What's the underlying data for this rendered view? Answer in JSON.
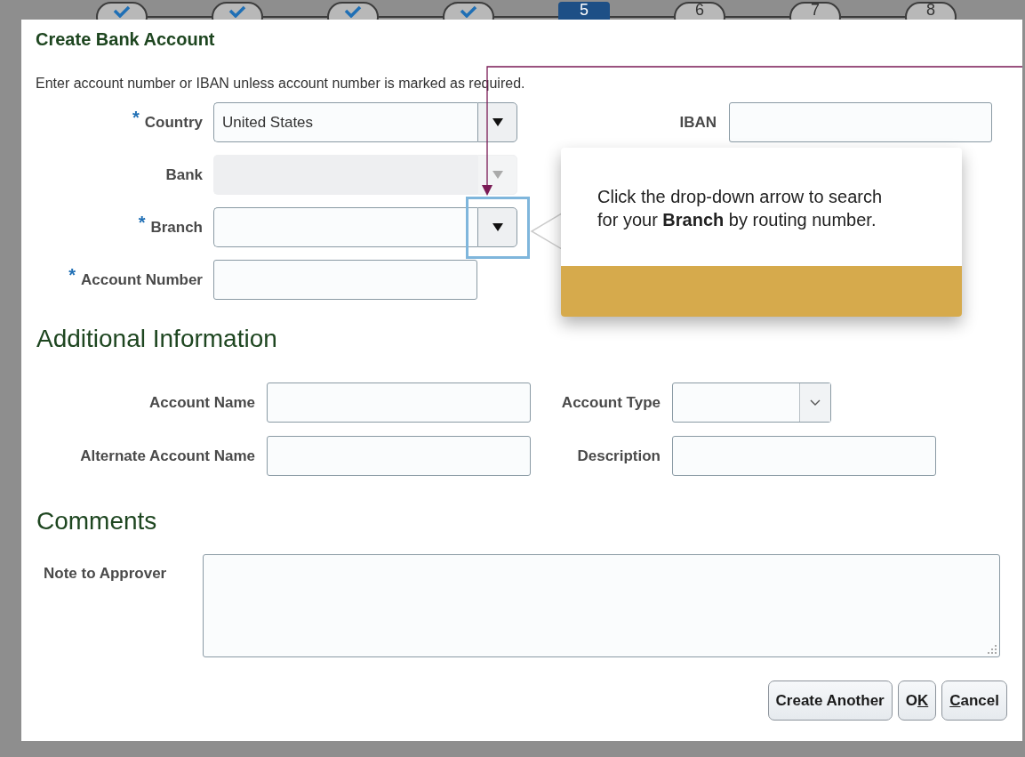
{
  "steps": [
    {
      "kind": "done"
    },
    {
      "kind": "done"
    },
    {
      "kind": "done"
    },
    {
      "kind": "done"
    },
    {
      "kind": "current",
      "label": "5"
    },
    {
      "kind": "pending",
      "label": "6"
    },
    {
      "kind": "pending",
      "label": "7"
    },
    {
      "kind": "pending",
      "label": "8"
    }
  ],
  "dialog": {
    "title": "Create Bank Account",
    "instruction": "Enter account number or IBAN unless account number is marked as required.",
    "fields": [
      {
        "kind": "select",
        "label": "Country",
        "marker": "*",
        "value": "United States",
        "disabled": false,
        "highlighted": false
      },
      {
        "kind": "select",
        "label": "Bank",
        "disabled": true,
        "highlighted": false
      },
      {
        "kind": "select",
        "label": "Branch",
        "marker": "*",
        "disabled": false,
        "highlighted": true
      },
      {
        "kind": "text",
        "label": "Account Number",
        "marker": "*"
      }
    ],
    "iban": {
      "label": "IBAN"
    },
    "additional": {
      "heading": "Additional Information",
      "fields": [
        {
          "kind": "text",
          "label": "Account Name"
        },
        {
          "kind": "choice",
          "label": "Account Type"
        },
        {
          "kind": "text",
          "label": "Alternate Account Name"
        },
        {
          "kind": "text",
          "label": "Description"
        }
      ]
    },
    "comments": {
      "heading": "Comments",
      "label": "Note to Approver"
    },
    "buttons": [
      {
        "parts": [
          {
            "text": "Create Another",
            "underlined": false
          }
        ]
      },
      {
        "parts": [
          {
            "text": "O",
            "underlined": false
          },
          {
            "text": "K",
            "underlined": true
          }
        ]
      },
      {
        "parts": [
          {
            "text": "C",
            "underlined": true
          },
          {
            "text": "ancel",
            "underlined": false
          }
        ]
      }
    ]
  },
  "tooltip": {
    "text": "Click the drop-down arrow to search for your **Branch** by routing number."
  }
}
